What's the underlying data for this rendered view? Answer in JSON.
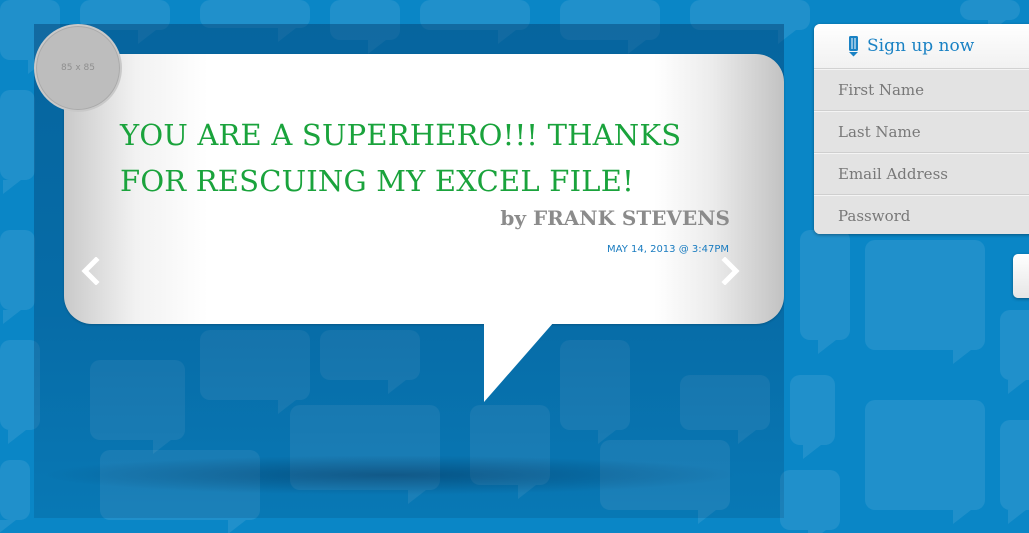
{
  "testimonial": {
    "avatar_label": "85 x 85",
    "quote": "YOU ARE A SUPERHERO!!! THANKS FOR RESCUING MY EXCEL FILE!",
    "author_prefix": "by",
    "author_name": "FRANK STEVENS",
    "date": "MAY 14, 2013 @ 3:47PM"
  },
  "signup": {
    "title": "Sign up now",
    "fields": [
      {
        "placeholder": "First Name"
      },
      {
        "placeholder": "Last Name"
      },
      {
        "placeholder": "Email Address"
      },
      {
        "placeholder": "Password"
      }
    ]
  },
  "icons": {
    "prev": "chevron-left-icon",
    "next": "chevron-right-icon",
    "signup": "pencil-icon"
  },
  "colors": {
    "background": "#0a86c6",
    "quote": "#1aa33c",
    "author": "#8b8b8b",
    "date": "#1a7cc0",
    "signup_title": "#1a82c4"
  }
}
